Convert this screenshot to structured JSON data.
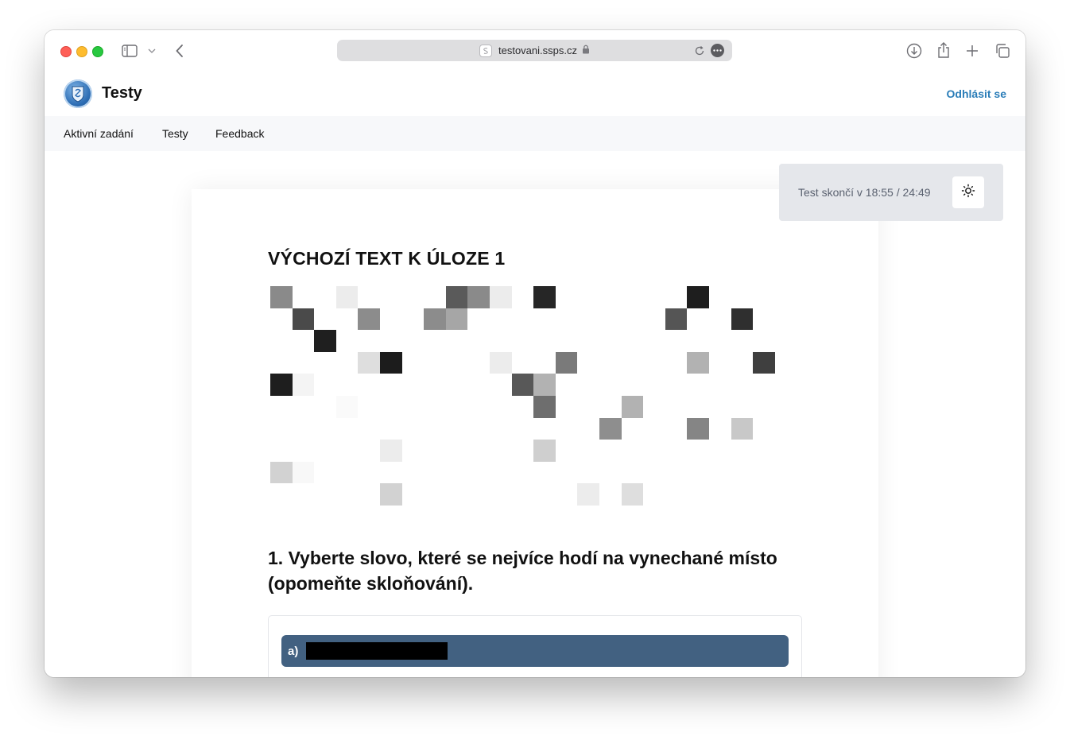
{
  "browser": {
    "url": "testovani.ssps.cz"
  },
  "header": {
    "title": "Testy",
    "logout_label": "Odhlásit se"
  },
  "nav": {
    "items": [
      {
        "label": "Aktivní zadání"
      },
      {
        "label": "Testy"
      },
      {
        "label": "Feedback"
      }
    ]
  },
  "timer": {
    "text": "Test skončí v 18:55 / 24:49"
  },
  "task": {
    "source_heading": "VÝCHOZÍ TEXT K ÚLOZE 1",
    "question": "1. Vyberte slovo, které se nejvíce hodí na vynechané místo (opomeňte skloňování).",
    "answers": [
      {
        "letter": "a)"
      }
    ]
  },
  "icons": {
    "sidebar": "sidebar-icon",
    "back": "chevron-left-icon",
    "lock": "lock-icon",
    "reload": "reload-icon",
    "more": "more-icon",
    "download": "download-icon",
    "share": "share-icon",
    "new_tab": "plus-icon",
    "tabs": "tabs-overview-icon",
    "theme": "sun-icon"
  },
  "colors": {
    "accent_link": "#2a7db8",
    "answer_bg": "#426181",
    "nav_bg": "#f7f8fa",
    "timer_bg": "#e5e7eb"
  }
}
